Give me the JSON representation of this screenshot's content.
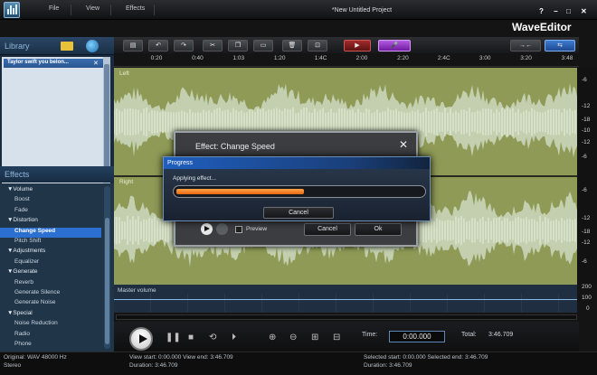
{
  "menu": {
    "file": "File",
    "view": "View",
    "effects": "Effects"
  },
  "window": {
    "title": "*New Untitled Project",
    "help": "?",
    "minimize": "−",
    "maximize": "□",
    "close": "✕"
  },
  "brand": "WaveEditor",
  "library": {
    "title": "Library",
    "item": "Taylor swift you belon..."
  },
  "effects_panel": {
    "title": "Effects",
    "rows": [
      {
        "label": "▼Volume",
        "kind": "cat"
      },
      {
        "label": "Boost",
        "kind": "item"
      },
      {
        "label": "Fade",
        "kind": "item"
      },
      {
        "label": "▼Distortion",
        "kind": "cat"
      },
      {
        "label": "Change Speed",
        "kind": "sel"
      },
      {
        "label": "Pitch Shift",
        "kind": "item"
      },
      {
        "label": "▼Adjustments",
        "kind": "cat"
      },
      {
        "label": "Equalizer",
        "kind": "item"
      },
      {
        "label": "▼Generate",
        "kind": "cat"
      },
      {
        "label": "Reverb",
        "kind": "item"
      },
      {
        "label": "Generate Silence",
        "kind": "item"
      },
      {
        "label": "Generate Noise",
        "kind": "item"
      },
      {
        "label": "▼Special",
        "kind": "cat"
      },
      {
        "label": "Noise Reduction",
        "kind": "item"
      },
      {
        "label": "Radio",
        "kind": "item"
      },
      {
        "label": "Phone",
        "kind": "item"
      }
    ]
  },
  "timeline": {
    "ticks": [
      "0:20",
      "0:40",
      "1:03",
      "1:20",
      "1:4C",
      "2:00",
      "2:20",
      "2:4C",
      "3:00",
      "3:20",
      "3:48"
    ]
  },
  "channels": {
    "left": "Left",
    "right": "Right"
  },
  "db_scale": [
    "-6",
    "-12",
    "-18",
    "-10",
    "-12",
    "-6",
    "-6",
    "-12",
    "-18",
    "-12",
    "-6"
  ],
  "master": {
    "label": "Master volume",
    "scale": [
      "200",
      "100",
      "0"
    ]
  },
  "transport": {
    "time_label": "Time:",
    "time_value": "0:00.000",
    "total_label": "Total:",
    "total_value": "3:46.709"
  },
  "status": {
    "format": "Original: WAV  48000 Hz",
    "channels": "Stereo",
    "view_start": "View start: 0:00.000  View end: 3:46.709",
    "view_duration": "Duration: 3:46.709",
    "selected": "Selected start: 0:00.000  Selected end: 3:46.709",
    "selected_duration": "Duration: 3:46.709"
  },
  "effect_dialog": {
    "title": "Effect: Change Speed",
    "close": "✕",
    "preview": "Preview",
    "cancel": "Cancel",
    "ok": "Ok"
  },
  "progress_dialog": {
    "title": "Progress",
    "text": "Applying effect...",
    "percent": 52,
    "cancel": "Cancel"
  },
  "colors": {
    "wave_bg": "#8e9a55",
    "wave": "#ccd8c0",
    "progress": "#f08a2a",
    "selected_effect": "#2b6fd0"
  }
}
